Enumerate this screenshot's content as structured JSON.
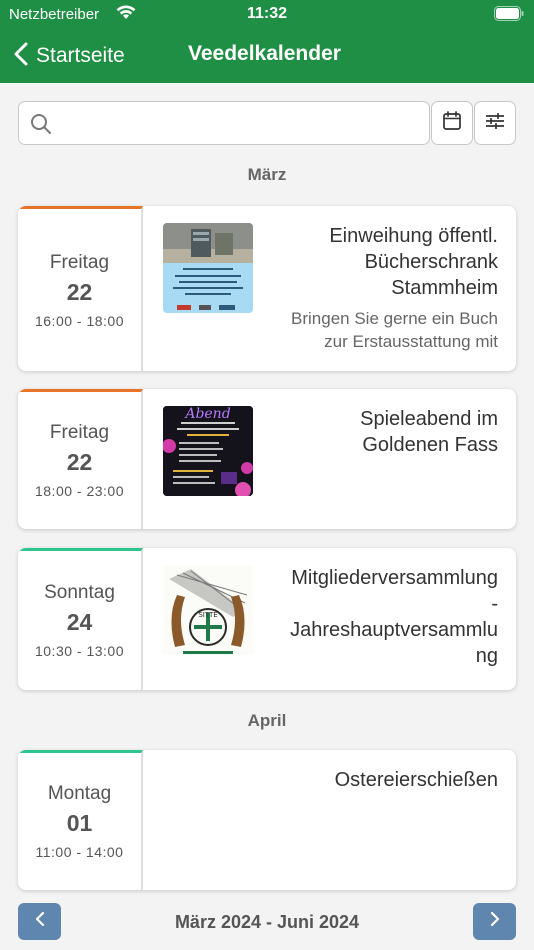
{
  "status": {
    "carrier": "Netzbetreiber",
    "time": "11:32"
  },
  "nav": {
    "back_label": "Startseite",
    "title": "Veedelkalender"
  },
  "search": {
    "placeholder": ""
  },
  "months": [
    "März",
    "April"
  ],
  "events": [
    {
      "weekday": "Freitag",
      "day": "22",
      "time": "16:00 - 18:00",
      "title_lines": [
        "Einweihung öffentl.",
        "Bücherschrank",
        "Stammheim"
      ],
      "subtitle_lines": [
        "Bringen Sie gerne ein Buch",
        "zur Erstausstattung mit"
      ]
    },
    {
      "weekday": "Freitag",
      "day": "22",
      "time": "18:00 - 23:00",
      "title_lines": [
        "Spieleabend im",
        "Goldenen Fass"
      ],
      "thumb_text": "Abend"
    },
    {
      "weekday": "Sonntag",
      "day": "24",
      "time": "10:30 - 13:00",
      "title_lines": [
        "Mitgliederversammlung",
        "-",
        "Jahreshauptversammlu",
        "ng"
      ],
      "thumb_text": "SITTE"
    },
    {
      "weekday": "Montag",
      "day": "01",
      "time": "11:00 - 14:00",
      "title_lines": [
        "Ostereierschießen"
      ]
    }
  ],
  "footer": {
    "range": "März 2024 - Juni 2024"
  },
  "colors": {
    "header": "#1f8f45",
    "accent_orange": "#e8742a",
    "accent_green": "#2fc58f",
    "footer_button": "#5e86ae"
  }
}
